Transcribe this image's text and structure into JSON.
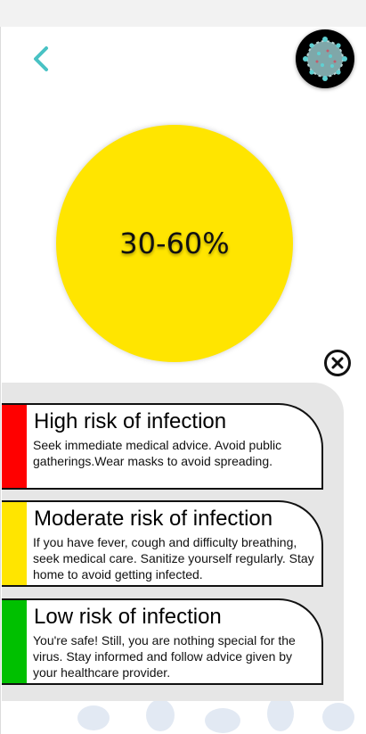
{
  "header": {
    "back_icon": "chevron-left-icon",
    "avatar_icon": "virus-icon"
  },
  "risk": {
    "value_text": "30-60%",
    "color": "#ffe500"
  },
  "close_icon": "close-circle-icon",
  "cards": [
    {
      "title": "High risk of infection",
      "description": "Seek immediate medical advice. Avoid public gatherings.Wear masks to avoid spreading.",
      "color": "#ff0000"
    },
    {
      "title": "Moderate risk of infection",
      "description": "If you have fever, cough and difficulty breathing, seek medical care. Sanitize yourself regularly. Stay home to avoid getting infected.",
      "color": "#ffe500"
    },
    {
      "title": "Low risk of infection",
      "description": "You're safe! Still, you are nothing special for the virus. Stay informed and follow advice given by your healthcare provider.",
      "color": "#00c000"
    }
  ],
  "colors": {
    "accent": "#3fbfbf",
    "panel": "#e6e6e6"
  }
}
